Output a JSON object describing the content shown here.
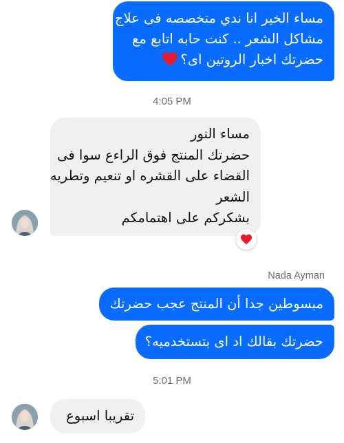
{
  "messages": {
    "first_outgoing": {
      "lines": [
        "مساء الخير انا ندي متخصصه فى علاج",
        "مشاكل الشعر .. كنت حابه اتابع مع",
        "حضرتك اخبار الروتين اى؟"
      ],
      "emoji": "heart-icon"
    },
    "timestamp_1": "4:05 PM",
    "first_incoming": {
      "lines": [
        "مساء النور",
        "حضرتك المنتج فوق الراءع سوا فى",
        "القضاء على القشره او تنعيم وتطريه",
        "الشعر",
        "بشكركم على اهتمامكم"
      ],
      "reaction": "heart-icon"
    },
    "sender_name": "Nada Ayman",
    "second_outgoing": "مبسوطين جدا أن المنتج عجب حضرتك",
    "third_outgoing": "حضرتك بقالك اد اى بتستخدميه؟",
    "timestamp_2": "5:01 PM",
    "second_incoming": "تقريبا اسبوع"
  },
  "colors": {
    "outgoing_bubble": "#0a6cff",
    "incoming_bubble": "#f0f0f2",
    "heart": "#e8192c"
  }
}
